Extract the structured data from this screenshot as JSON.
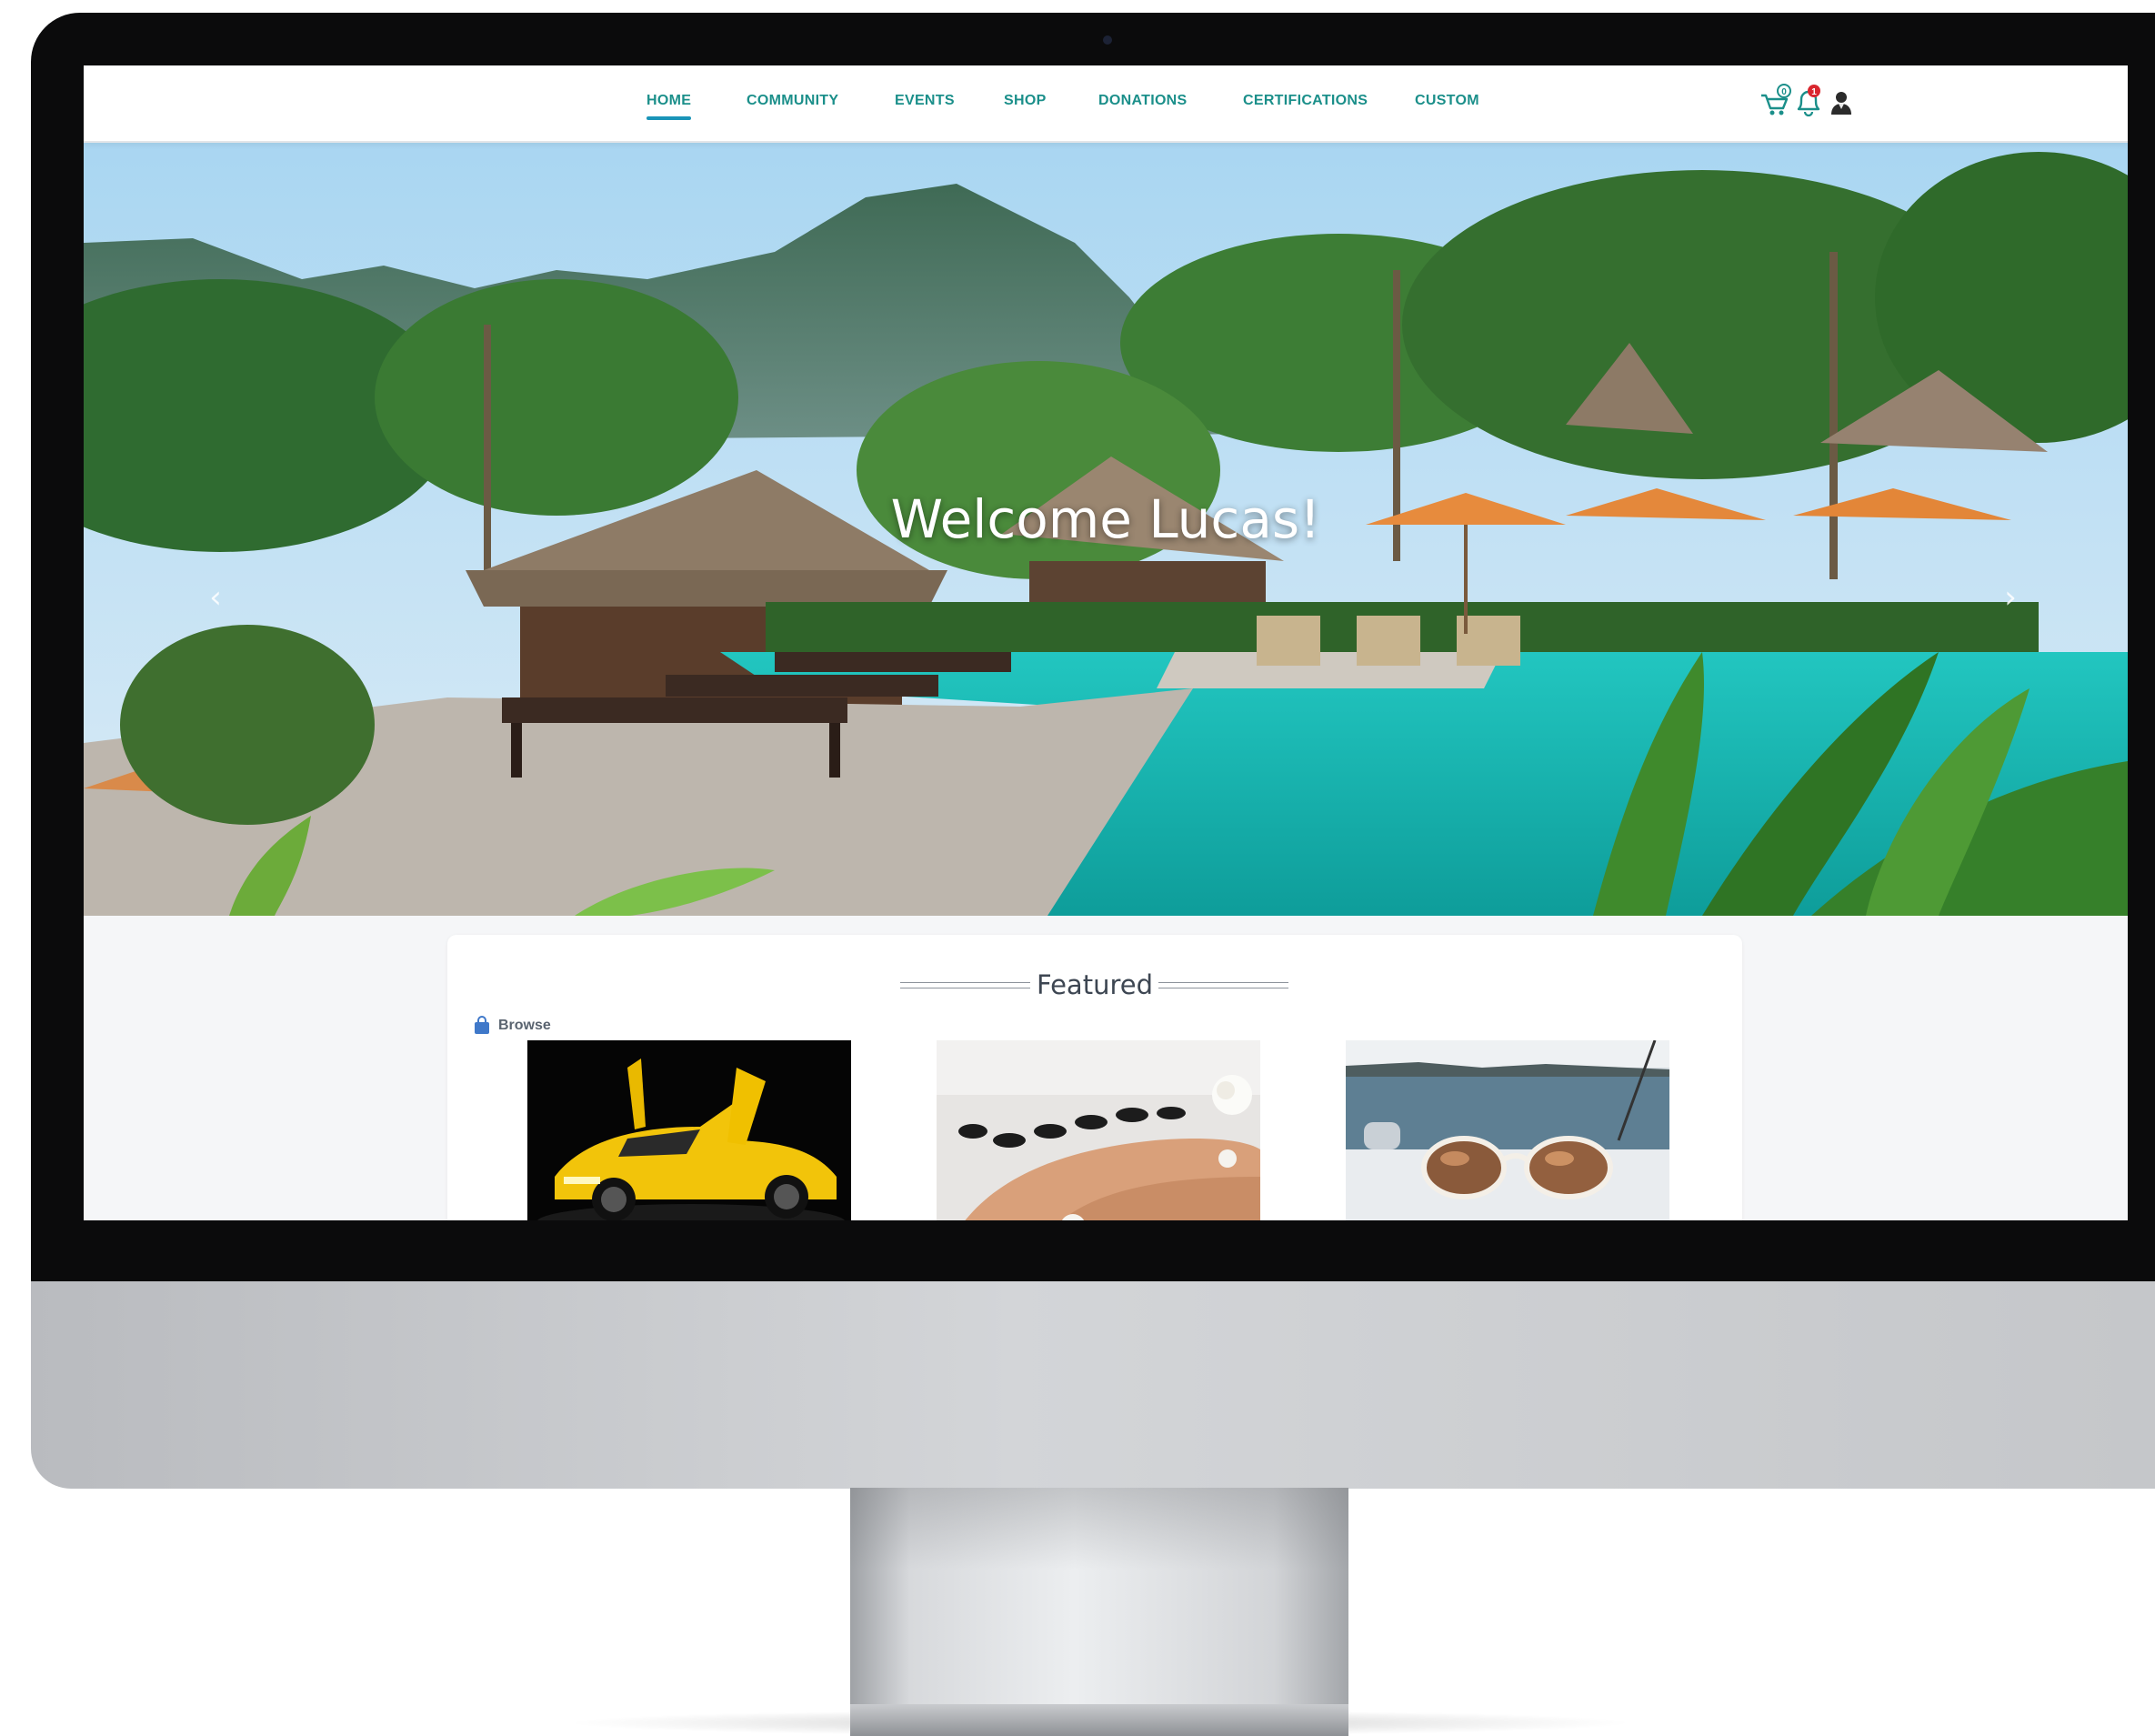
{
  "nav": {
    "items": [
      {
        "label": "HOME",
        "active": true
      },
      {
        "label": "COMMUNITY",
        "active": false
      },
      {
        "label": "EVENTS",
        "active": false
      },
      {
        "label": "SHOP",
        "active": false
      },
      {
        "label": "DONATIONS",
        "active": false
      },
      {
        "label": "CERTIFICATIONS",
        "active": false
      },
      {
        "label": "CUSTOM",
        "active": false
      }
    ],
    "icons": [
      {
        "name": "cart-icon",
        "badge": "0"
      },
      {
        "name": "bell-icon",
        "badge": "1"
      },
      {
        "name": "user-avatar-icon",
        "badge": ""
      }
    ]
  },
  "hero": {
    "welcome": "Welcome Lucas!",
    "prev_arrow": "‹",
    "next_arrow": "›"
  },
  "featured": {
    "title": "Featured",
    "browse_label": "Browse",
    "products": [
      {
        "name": "yellow-sports-car-image"
      },
      {
        "name": "black-bead-bracelet-image"
      },
      {
        "name": "sunglasses-on-boat-image"
      }
    ]
  },
  "colors": {
    "nav_text": "#1b8f8a",
    "nav_active_underline": "#1a94b8",
    "badge_red": "#d9262e",
    "page_bg": "#f5f6f8"
  }
}
